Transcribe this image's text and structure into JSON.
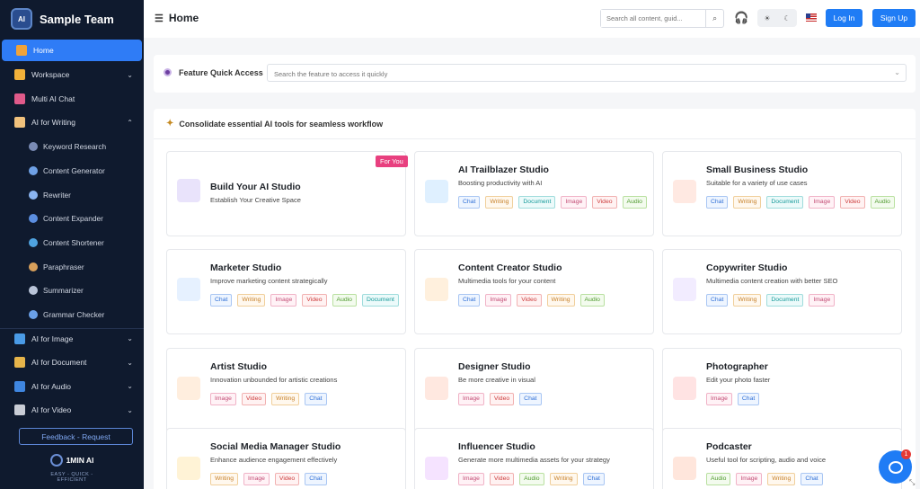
{
  "brand": {
    "name": "Sample Team",
    "logo_text": "AI"
  },
  "sidebar": {
    "items": [
      {
        "label": "Home",
        "active": true,
        "icon": "home-icon",
        "color": "#f0a33b"
      },
      {
        "label": "Workspace",
        "icon": "chart-bars-icon",
        "color": "#f2b13a",
        "chevron": "⌄"
      },
      {
        "label": "Multi AI Chat",
        "icon": "network-icon",
        "color": "#e05a8a"
      },
      {
        "label": "AI for Writing",
        "icon": "notebook-icon",
        "color": "#f1c27d",
        "chevron": "⌃"
      }
    ],
    "writing_sub": [
      {
        "label": "Keyword Research",
        "color": "#7a8bb5"
      },
      {
        "label": "Content Generator",
        "color": "#6fa1e6"
      },
      {
        "label": "Rewriter",
        "color": "#8ab4f0"
      },
      {
        "label": "Content Expander",
        "color": "#5b8ee0"
      },
      {
        "label": "Content Shortener",
        "color": "#4fa3e0"
      },
      {
        "label": "Paraphraser",
        "color": "#d9a05b"
      },
      {
        "label": "Summarizer",
        "color": "#b9c4d8"
      },
      {
        "label": "Grammar Checker",
        "color": "#6aa0e8"
      }
    ],
    "more_items": [
      {
        "label": "AI for Image",
        "icon": "image-icon",
        "color": "#4a9be6",
        "chevron": "⌄"
      },
      {
        "label": "AI for Document",
        "icon": "book-icon",
        "color": "#e6b44a",
        "chevron": "⌄"
      },
      {
        "label": "AI for Audio",
        "icon": "speaker-icon",
        "color": "#3f86e0",
        "chevron": "⌄"
      },
      {
        "label": "AI for Video",
        "icon": "video-icon",
        "color": "#c9cdd6",
        "chevron": "⌄"
      }
    ],
    "feedback_label": "Feedback - Request",
    "footer_logo_name": "1MIN AI",
    "footer_tagline": "EASY - QUICK - EFFICIENT"
  },
  "header": {
    "title": "Home",
    "search_placeholder": "Search all content, guid...",
    "login_label": "Log In",
    "signup_label": "Sign Up"
  },
  "quick_access": {
    "label": "Feature Quick Access",
    "placeholder": "Search the feature to access it quickly"
  },
  "section": {
    "heading": "Consolidate essential AI tools for seamless workflow"
  },
  "for_you_badge": "For You",
  "cards": [
    {
      "title": "Build Your AI Studio",
      "subtitle": "Establish Your Creative Space",
      "tags": [],
      "thumb_color": "#e9e3fb"
    },
    {
      "title": "AI Trailblazer Studio",
      "subtitle": "Boosting productivity with AI",
      "tags": [
        "Chat",
        "Writing",
        "Document",
        "Image",
        "Video",
        "Audio"
      ],
      "thumb_color": "#dff0ff"
    },
    {
      "title": "Small Business Studio",
      "subtitle": "Suitable for a variety of use cases",
      "tags": [
        "Chat",
        "Writing",
        "Document",
        "Image",
        "Video",
        "Audio"
      ],
      "thumb_color": "#ffe9e2"
    },
    {
      "title": "Marketer Studio",
      "subtitle": "Improve marketing content strategically",
      "tags": [
        "Chat",
        "Writing",
        "Image",
        "Video",
        "Audio",
        "Document"
      ],
      "thumb_color": "#e6f1ff"
    },
    {
      "title": "Content Creator Studio",
      "subtitle": "Multimedia tools for your content",
      "tags": [
        "Chat",
        "Image",
        "Video",
        "Writing",
        "Audio"
      ],
      "thumb_color": "#fff0dd"
    },
    {
      "title": "Copywriter Studio",
      "subtitle": "Multimedia content creation with better SEO",
      "tags": [
        "Chat",
        "Writing",
        "Document",
        "Image"
      ],
      "thumb_color": "#f2ecff"
    },
    {
      "title": "Artist Studio",
      "subtitle": "Innovation unbounded for artistic creations",
      "tags": [
        "Image",
        "Video",
        "Writing",
        "Chat"
      ],
      "thumb_color": "#ffeede"
    },
    {
      "title": "Designer Studio",
      "subtitle": "Be more creative in visual",
      "tags": [
        "Image",
        "Video",
        "Chat"
      ],
      "thumb_color": "#ffe8e0"
    },
    {
      "title": "Photographer",
      "subtitle": "Edit your photo faster",
      "tags": [
        "Image",
        "Chat"
      ],
      "thumb_color": "#ffe3e3"
    },
    {
      "title": "Social Media Manager Studio",
      "subtitle": "Enhance audience engagement effectively",
      "tags": [
        "Writing",
        "Image",
        "Video",
        "Chat"
      ],
      "thumb_color": "#fff3d6"
    },
    {
      "title": "Influencer Studio",
      "subtitle": "Generate more multimedia assets for your strategy",
      "tags": [
        "Image",
        "Video",
        "Audio",
        "Writing",
        "Chat"
      ],
      "thumb_color": "#f5e3ff"
    },
    {
      "title": "Podcaster",
      "subtitle": "Useful tool for scripting, audio and voice",
      "tags": [
        "Audio",
        "Image",
        "Writing",
        "Chat"
      ],
      "thumb_color": "#ffe6dc"
    }
  ],
  "chat_badge": "1",
  "colors": {
    "accent": "#1f7cf5",
    "sidebar_bg": "#0f1a2e",
    "badge": "#e8407f"
  }
}
